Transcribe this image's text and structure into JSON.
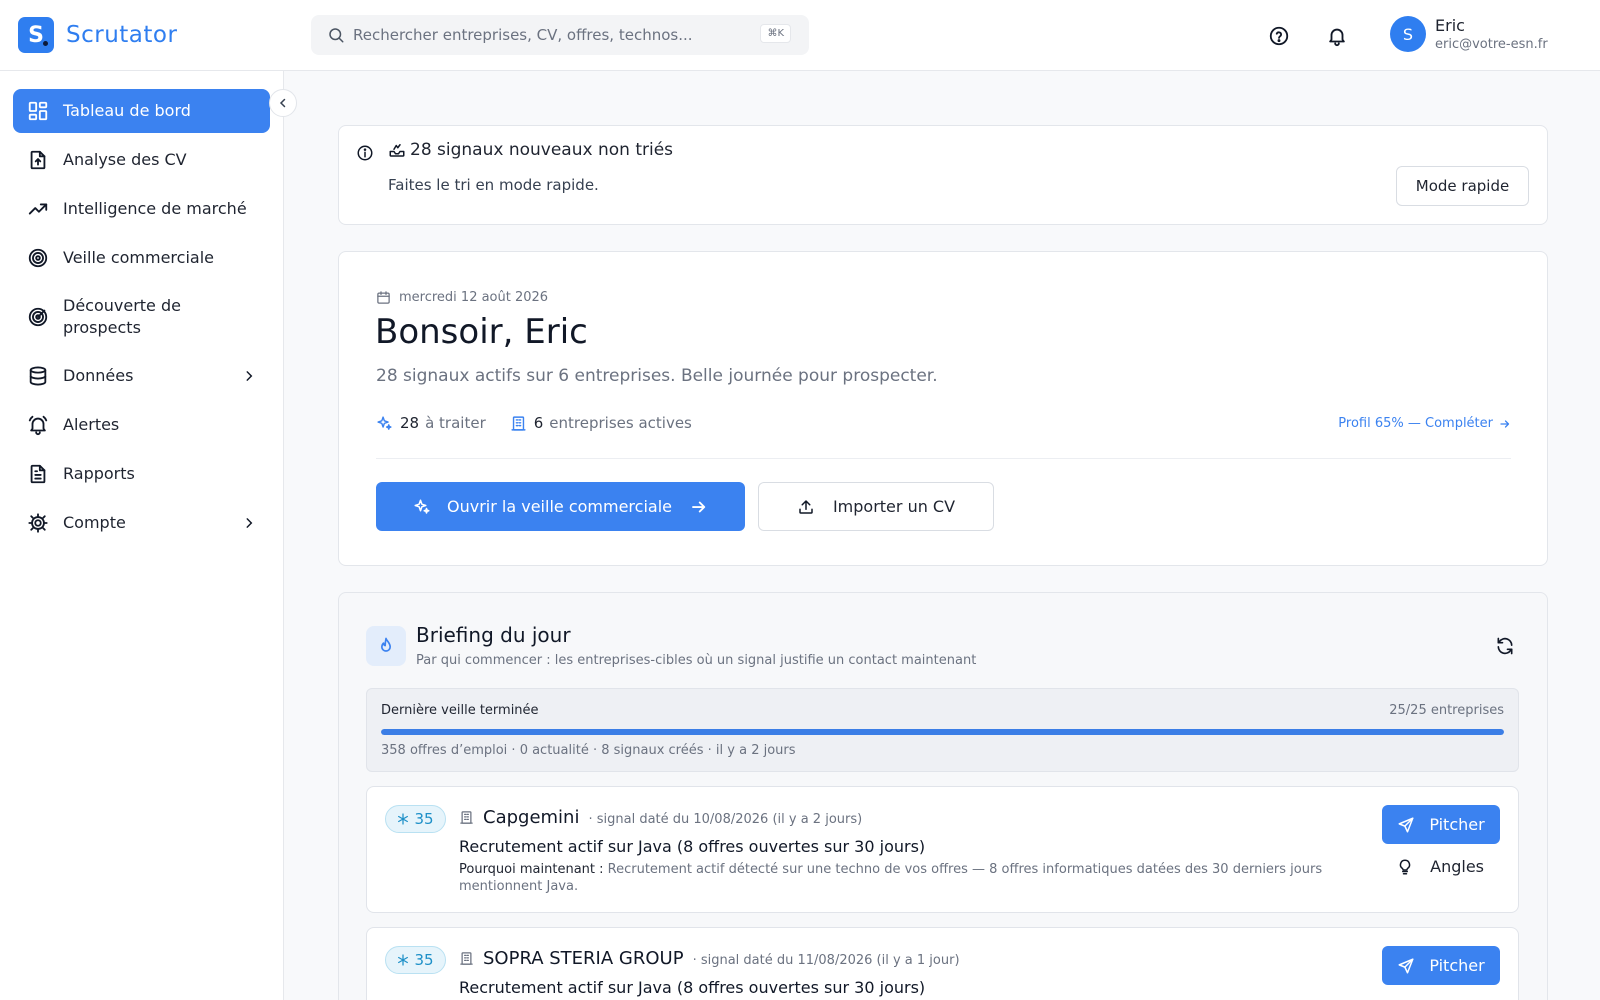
{
  "app": {
    "logo_letter": "S",
    "name": "Scrutator",
    "brand_color": "#2f7ef0"
  },
  "search": {
    "placeholder": "Rechercher entreprises, CV, offres, technos...",
    "shortcut": "⌘K"
  },
  "topbar": {
    "help_icon": "help-circle-icon",
    "bell_icon": "bell-icon"
  },
  "user": {
    "initial": "S",
    "name": "Eric",
    "email": "eric@votre-esn.fr"
  },
  "sidebar": {
    "items": [
      {
        "label": "Tableau de bord",
        "icon": "dashboard-grid-icon",
        "active": true
      },
      {
        "label": "Analyse des CV",
        "icon": "file-upload-icon"
      },
      {
        "label": "Intelligence de marché",
        "icon": "trending-up-icon"
      },
      {
        "label": "Veille commerciale",
        "icon": "target-icon"
      },
      {
        "label": "Découverte de prospects",
        "icon": "radar-icon"
      },
      {
        "label": "Données",
        "icon": "database-icon",
        "has_children": true
      },
      {
        "label": "Alertes",
        "icon": "bell-ring-icon"
      },
      {
        "label": "Rapports",
        "icon": "report-icon"
      },
      {
        "label": "Compte",
        "icon": "gear-icon",
        "has_children": true
      }
    ]
  },
  "notice": {
    "title": "28 signaux nouveaux non triés",
    "subtitle": "Faites le tri en mode rapide.",
    "button": "Mode rapide"
  },
  "hero": {
    "date": "mercredi 12 août 2026",
    "greeting": "Bonsoir, Eric",
    "tagline": "28 signaux actifs sur 6 entreprises. Belle journée pour prospecter.",
    "stat_todo_count": "28",
    "stat_todo_label": "à traiter",
    "stat_companies_count": "6",
    "stat_companies_label": "entreprises actives",
    "profile_link": "Profil 65% — Compléter",
    "primary_button": "Ouvrir la veille commerciale",
    "import_button": "Importer un CV"
  },
  "briefing": {
    "title": "Briefing du jour",
    "subtitle": "Par qui commencer : les entreprises-cibles où un signal justifie un contact maintenant",
    "progress": {
      "label": "Dernière veille terminée",
      "count": "25/25 entreprises",
      "fraction": 1.0,
      "meta": "358 offres d’emploi · 0 actualité · 8 signaux créés · il y a 2 jours"
    },
    "signals": [
      {
        "score": "35",
        "company": "Capgemini",
        "date": "· signal daté du 10/08/2026 (il y a 2 jours)",
        "title": "Recrutement actif sur Java (8 offres ouvertes sur 30 jours)",
        "why_label": "Pourquoi maintenant :",
        "why_text": "Recrutement actif détecté sur une techno de vos offres — 8 offres informatiques datées des 30 derniers jours mentionnent Java.",
        "pitch": "Pitcher",
        "angles": "Angles"
      },
      {
        "score": "35",
        "company": "SOPRA STERIA GROUP",
        "date": "· signal daté du 11/08/2026 (il y a 1 jour)",
        "title": "Recrutement actif sur Java (8 offres ouvertes sur 30 jours)",
        "pitch": "Pitcher"
      }
    ]
  }
}
